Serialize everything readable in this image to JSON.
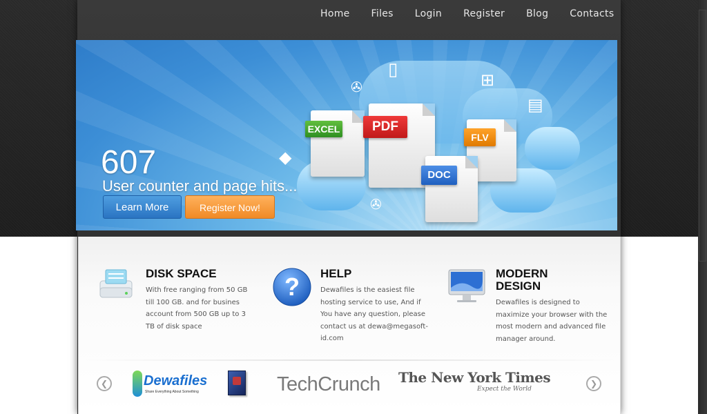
{
  "nav": {
    "items": [
      "Home",
      "Files",
      "Login",
      "Register",
      "Blog",
      "Contacts"
    ]
  },
  "banner": {
    "counter": "607",
    "counter_caption": "User counter and page hits...",
    "learn_more": "Learn More",
    "register_now": "Register Now!",
    "file_tags": {
      "excel": "EXCEL",
      "pdf": "PDF",
      "flv": "FLV",
      "doc": "DOC"
    }
  },
  "features": [
    {
      "title": "DISK SPACE",
      "text": [
        "With free ranging from 50 GB",
        "till 100 GB. and for busines",
        "account from 500 GB up to 3",
        "TB of disk space"
      ],
      "icon": "hard-drive-icon"
    },
    {
      "title": "HELP",
      "text": [
        "Dewafiles is the easiest file",
        "hosting service to use, And if",
        "You have any question, please",
        "contact us at dewa@megasoft-",
        "id.com"
      ],
      "icon": "help-icon"
    },
    {
      "title_lines": [
        "MODERN",
        "DESIGN"
      ],
      "text": [
        "Dewafiles is designed to",
        "maximize your browser with the",
        "most modern and advanced file",
        "manager around."
      ],
      "icon": "monitor-icon"
    }
  ],
  "partners": {
    "dewafiles": "Dewafiles",
    "dewafiles_tagline": "Share Everything About Something",
    "techcrunch": "TechCrunch",
    "nyt": "The New York Times",
    "nyt_tagline": "Expect the World"
  },
  "colors": {
    "accent_blue": "#2e7cc9",
    "register_orange": "#f08a26",
    "help_blue": "#1f5fbf"
  }
}
